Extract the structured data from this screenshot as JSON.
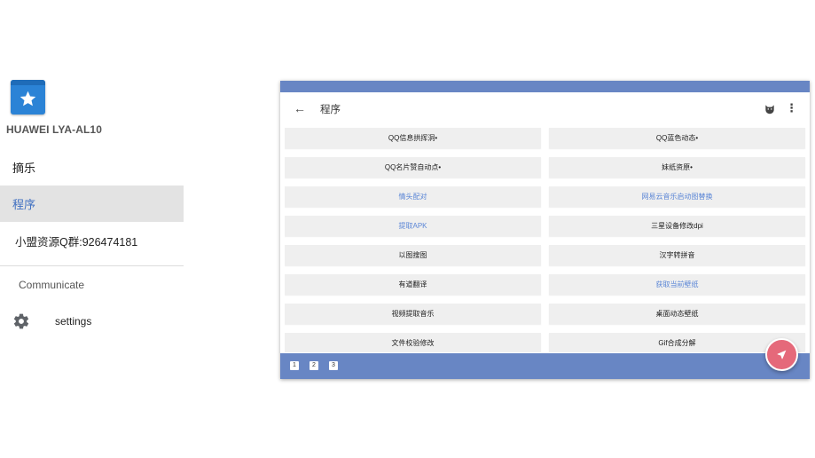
{
  "drawer": {
    "app_icon": "star-icon",
    "device_name": "HUAWEI LYA-AL10",
    "items": [
      {
        "label": "摘乐"
      },
      {
        "label": "程序"
      },
      {
        "label": "小盟资源Q群:926474181"
      }
    ],
    "section_header": "Communicate",
    "settings_label": "settings",
    "settings_icon": "gear-icon"
  },
  "screen": {
    "toolbar": {
      "title": "程序",
      "back_icon": "arrow-left-icon",
      "back_glyph": "←",
      "cat_icon": "cat-icon",
      "more_icon": "more-vert-icon",
      "more_glyph": "⋮"
    },
    "grid": [
      {
        "label": "QQ信息拱挥洞•",
        "link": false
      },
      {
        "label": "QQ蓝色动态•",
        "link": false
      },
      {
        "label": "QQ名片赞自动点•",
        "link": false
      },
      {
        "label": "妹纸资原•",
        "link": false
      },
      {
        "label": "情头配对",
        "link": true
      },
      {
        "label": "网易云音乐启动图替换",
        "link": true
      },
      {
        "label": "提取APK",
        "link": true
      },
      {
        "label": "三星设备修改dpi",
        "link": false
      },
      {
        "label": "以图搜图",
        "link": false
      },
      {
        "label": "汉字转拼音",
        "link": false
      },
      {
        "label": "有道翻译",
        "link": false
      },
      {
        "label": "获取当前壁纸",
        "link": true
      },
      {
        "label": "视频提取音乐",
        "link": false
      },
      {
        "label": "桌面动态壁纸",
        "link": false
      },
      {
        "label": "文件校验修改",
        "link": false
      },
      {
        "label": "Gif合成分解",
        "link": false
      }
    ],
    "pages": [
      "1",
      "2",
      "3"
    ],
    "fab_icon": "navigation-arrow-icon"
  },
  "colors": {
    "accent": "#6886c4",
    "active_text": "#3f6fc1",
    "link": "#5b86d6",
    "fab": "#e5697a",
    "app_icon": "#2b83d6"
  }
}
